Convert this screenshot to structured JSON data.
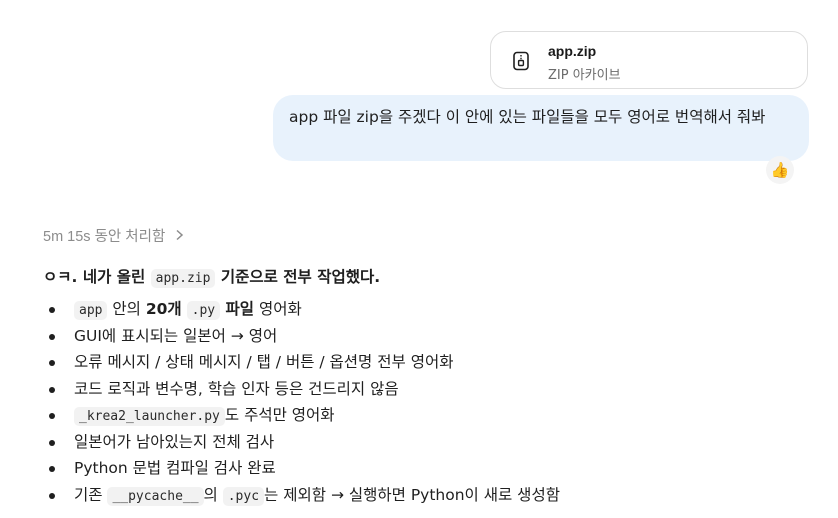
{
  "attachment": {
    "name": "app.zip",
    "type": "ZIP 아카이브",
    "icon": "zip-archive-icon"
  },
  "user_message": {
    "text": "app 파일 zip을 주겠다 이 안에 있는 파일들을 모두 영어로 번역해서 줘봐",
    "reaction_icon": "thumbs-up-icon"
  },
  "thought": {
    "label": "5m 15s 동안 처리함",
    "icon": "chevron-right-icon"
  },
  "response": {
    "summary": {
      "prefix": "ㅇㅋ. ",
      "bold1": "네가 올린 ",
      "code": "app.zip",
      "bold2": " 기준으로 전부 작업했다."
    },
    "items": [
      {
        "code": "app",
        "text1": " 안의 ",
        "bold": "20개",
        "text2": " ",
        "code2": ".py",
        "bold2": " 파일",
        "text3": " 영어화"
      },
      {
        "text": "GUI에 표시되는 일본어 → 영어"
      },
      {
        "text": "오류 메시지 / 상태 메시지 / 탭 / 버튼 / 옵션명 전부 영어화"
      },
      {
        "text": "코드 로직과 변수명, 학습 인자 등은 건드리지 않음"
      },
      {
        "code": "_krea2_launcher.py",
        "text": "도 주석만 영어화"
      },
      {
        "text": "일본어가 남아있는지 전체 검사"
      },
      {
        "text": "Python 문법 컴파일 검사 완료"
      },
      {
        "text1": "기존 ",
        "code1": "__pycache__",
        "text2": "의 ",
        "code2": ".pyc",
        "text3": "는 제외함 → 실행하면 Python이 새로 생성함"
      }
    ]
  }
}
